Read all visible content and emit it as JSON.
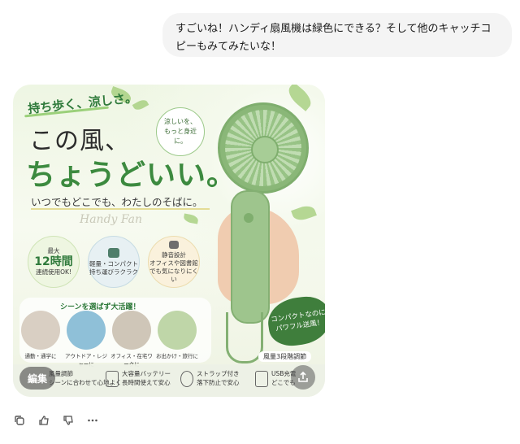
{
  "user_message": {
    "text": "すごいね！ハンディ扇風機は緑色にできる？そして他のキャッチコピーもみてみたいな！"
  },
  "image": {
    "tagline": "持ち歩く、涼しさ。",
    "headline_line1": "この風、",
    "headline_line2": "ちょうどいい。",
    "subheadline": "いつでもどこでも、わたしのそばに。",
    "script_text": "Handy Fan",
    "stamp": "涼しいを、もっと身近に。",
    "features": [
      {
        "top": "最大",
        "big": "12時間",
        "bottom": "連続使用OK!"
      },
      {
        "top": "軽量・コンパクト",
        "big": "",
        "bottom": "持ち運びラクラク"
      },
      {
        "top": "静音設計",
        "big": "",
        "bottom": "オフィスや図書館でも気になりにくい"
      }
    ],
    "scene_title": "シーンを選ばず大活躍！",
    "scenes": [
      "通勤・通学に",
      "アウトドア・レジャーに",
      "オフィス・在宅ワークに",
      "お出かけ・旅行に"
    ],
    "badge": "コンパクトなのにパワフル送風！",
    "badge_foot": "風量3段階調節",
    "bottom_items": [
      {
        "title": "風量調節",
        "desc": "シーンに合わせて心地よく"
      },
      {
        "title": "大容量バッテリー",
        "desc": "長時間使えて安心"
      },
      {
        "title": "ストラップ付き",
        "desc": "落下防止で安心"
      },
      {
        "title": "USB充電",
        "desc": "どこでも"
      }
    ],
    "edit_label": "編集",
    "share_icon": "share-icon"
  },
  "actions": [
    "copy-icon",
    "thumbs-up-icon",
    "thumbs-down-icon",
    "more-icon"
  ],
  "colors": {
    "accent_green": "#3c8a3f",
    "bubble_bg": "#f4f4f4"
  }
}
